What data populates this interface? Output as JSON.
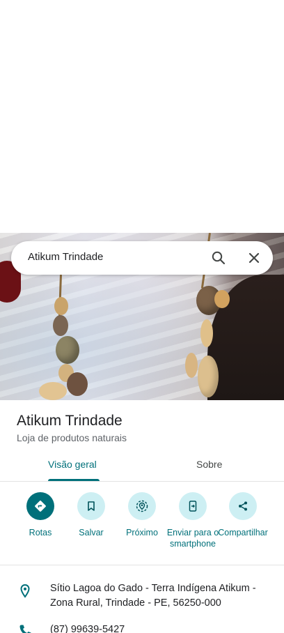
{
  "search": {
    "query": "Atikum Trindade"
  },
  "place": {
    "name": "Atikum Trindade",
    "category": "Loja de produtos naturais"
  },
  "tabs": [
    {
      "label": "Visão geral",
      "selected": true
    },
    {
      "label": "Sobre",
      "selected": false
    }
  ],
  "actions": [
    {
      "label": "Rotas",
      "icon": "directions-icon"
    },
    {
      "label": "Salvar",
      "icon": "bookmark-icon"
    },
    {
      "label": "Próximo",
      "icon": "nearby-icon"
    },
    {
      "label": "Enviar para o smartphone",
      "icon": "send-to-phone-icon"
    },
    {
      "label": "Compartilhar",
      "icon": "share-icon"
    }
  ],
  "info": {
    "address": "Sítio Lagoa do Gado - Terra Indígena Atikum - Zona Rural, Trindade - PE, 56250-000",
    "phone": "(87) 99639-5427"
  },
  "colors": {
    "accent": "#00707a",
    "action_bg": "#cdeff3"
  }
}
